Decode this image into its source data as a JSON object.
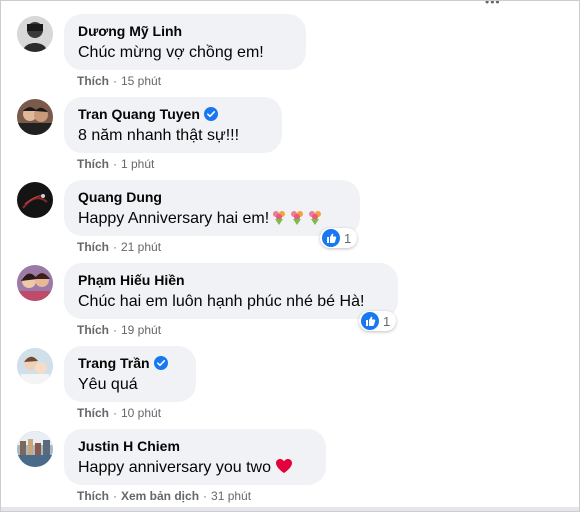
{
  "colors": {
    "bubble_bg": "#f0f2f5",
    "verified_blue": "#1877f2",
    "like_blue": "#1877f2",
    "heart_red": "#e4003b",
    "meta_gray": "#65676b"
  },
  "comments": [
    {
      "author": "Dương Mỹ Linh",
      "text": "Chúc mừng vợ chồng em!",
      "verified": false,
      "like_label": "Thích",
      "time": "15 phút",
      "avatar_icon": "avatar-icon"
    },
    {
      "author": "Tran Quang Tuyen",
      "text": "8 năm nhanh thật sự!!!",
      "verified": true,
      "like_label": "Thích",
      "time": "1 phút",
      "avatar_icon": "avatar-icon"
    },
    {
      "author": "Quang Dung",
      "text": "Happy Anniversary hai em!",
      "verified": false,
      "like_label": "Thích",
      "time": "21 phút",
      "reaction_count": "1",
      "emoji": "bouquet-icon",
      "avatar_icon": "avatar-icon"
    },
    {
      "author": "Phạm Hiếu Hiền",
      "text": "Chúc hai em luôn hạnh phúc nhé bé Hà!",
      "verified": false,
      "like_label": "Thích",
      "time": "19 phút",
      "reaction_count": "1",
      "avatar_icon": "avatar-icon"
    },
    {
      "author": "Trang Trần",
      "text": "Yêu quá",
      "verified": true,
      "like_label": "Thích",
      "time": "10 phút",
      "avatar_icon": "avatar-icon"
    },
    {
      "author": "Justin H Chiem",
      "text": "Happy anniversary you two",
      "verified": false,
      "like_label": "Thích",
      "translate_label": "Xem bản dịch",
      "time": "31 phút",
      "emoji": "heart-icon",
      "avatar_icon": "avatar-icon"
    }
  ]
}
